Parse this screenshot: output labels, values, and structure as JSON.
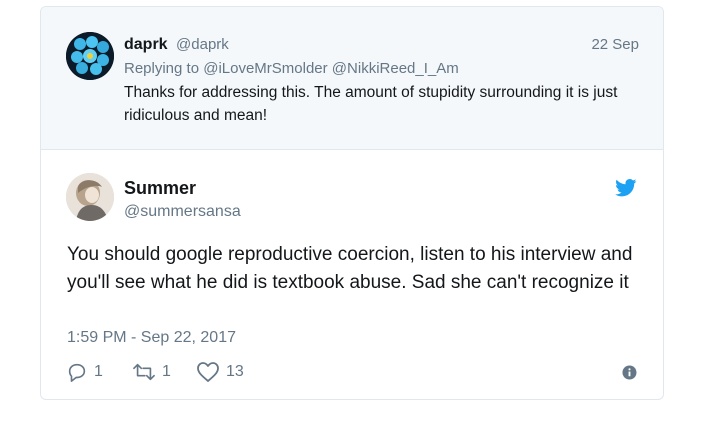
{
  "parent_tweet": {
    "display_name": "daprk",
    "handle": "@daprk",
    "date": "22 Sep",
    "replying_to": "Replying to @iLoveMrSmolder @NikkiReed_I_Am",
    "text": "Thanks for addressing this. The amount of stupidity surrounding it is just ridiculous and mean!"
  },
  "main_tweet": {
    "display_name": "Summer",
    "handle": "@summersansa",
    "text": "You should google reproductive coercion, listen to his interview and you'll see what he did is textbook abuse. Sad she can't recognize it",
    "timestamp": "1:59 PM - Sep 22, 2017",
    "replies": "1",
    "retweets": "1",
    "likes": "13"
  },
  "colors": {
    "accent": "#1da1f2",
    "muted": "#657786",
    "text": "#14171a",
    "parent_bg": "#f5f8fa"
  },
  "icons": [
    "reply-icon",
    "retweet-icon",
    "like-icon",
    "info-icon",
    "twitter-bird-icon"
  ]
}
